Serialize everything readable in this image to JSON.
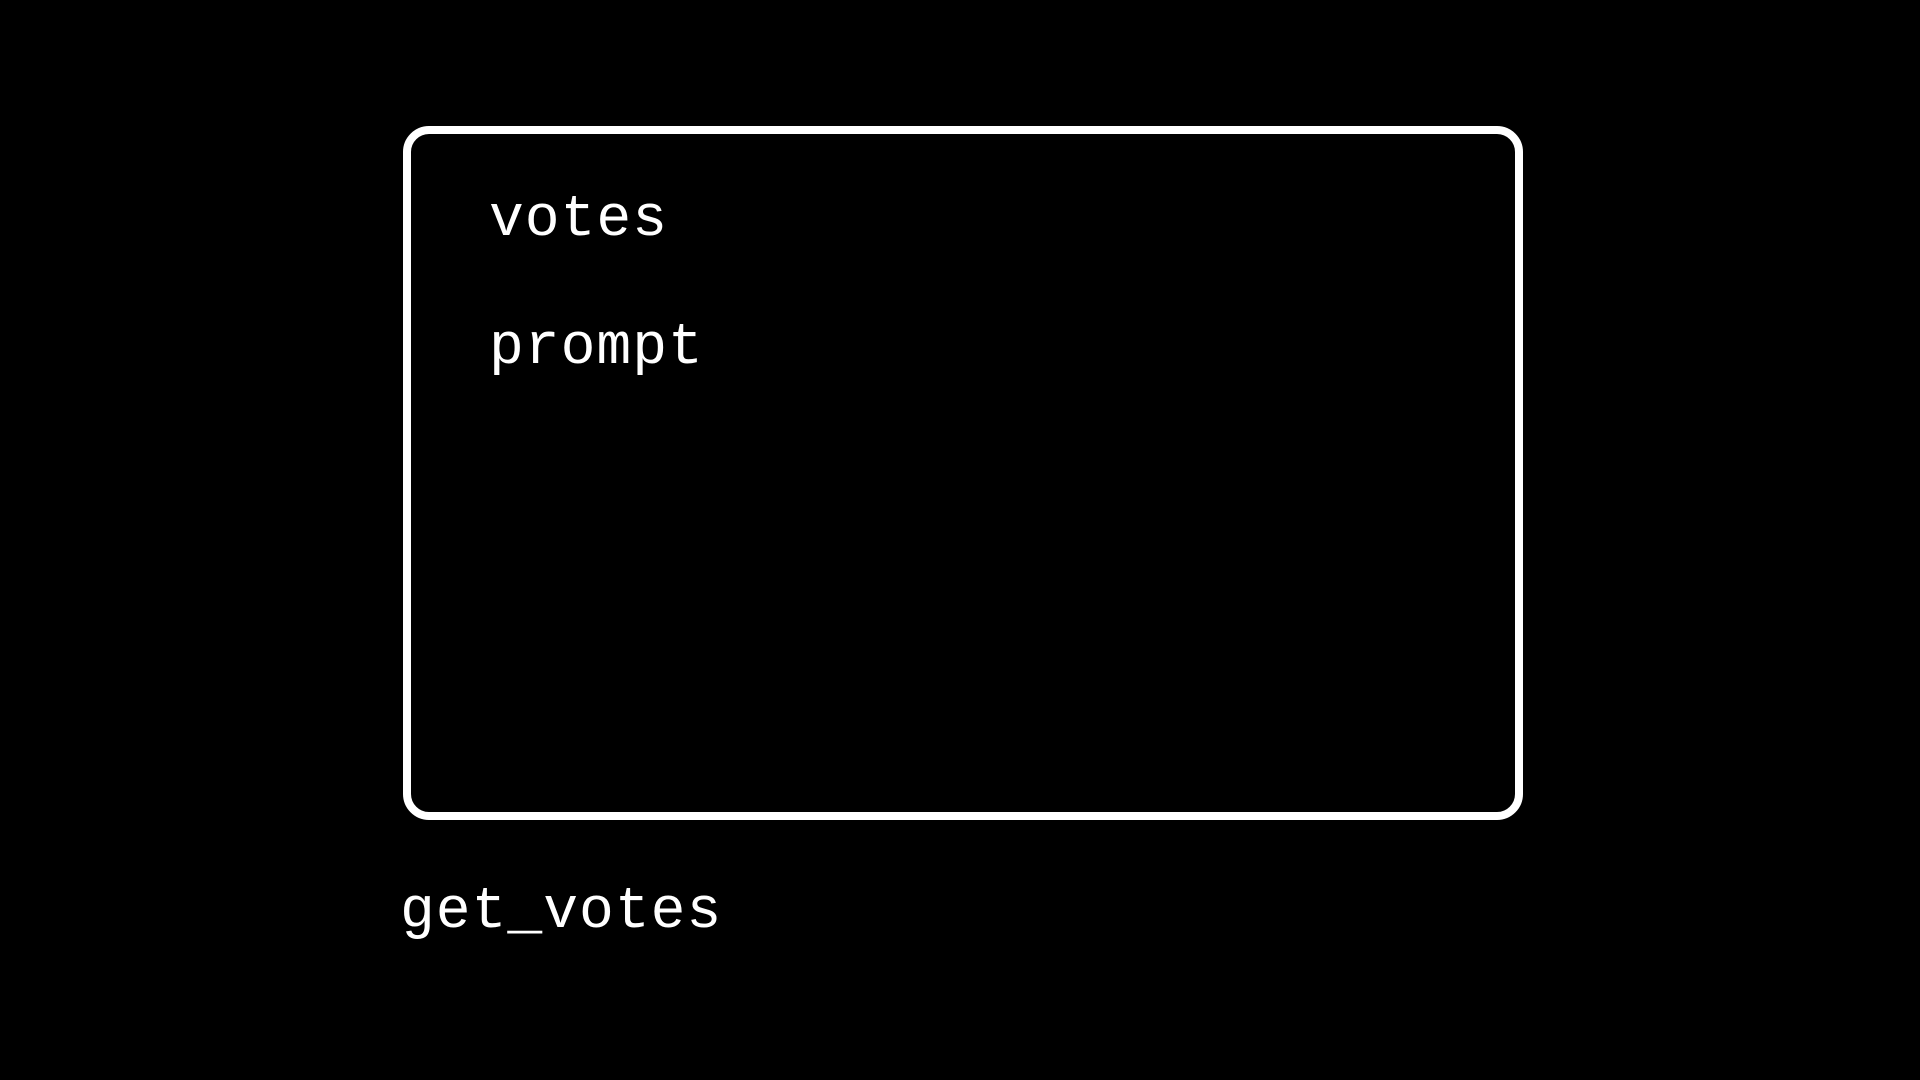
{
  "box": {
    "items": [
      {
        "label": "votes"
      },
      {
        "label": "prompt"
      }
    ]
  },
  "caption": "get_votes"
}
